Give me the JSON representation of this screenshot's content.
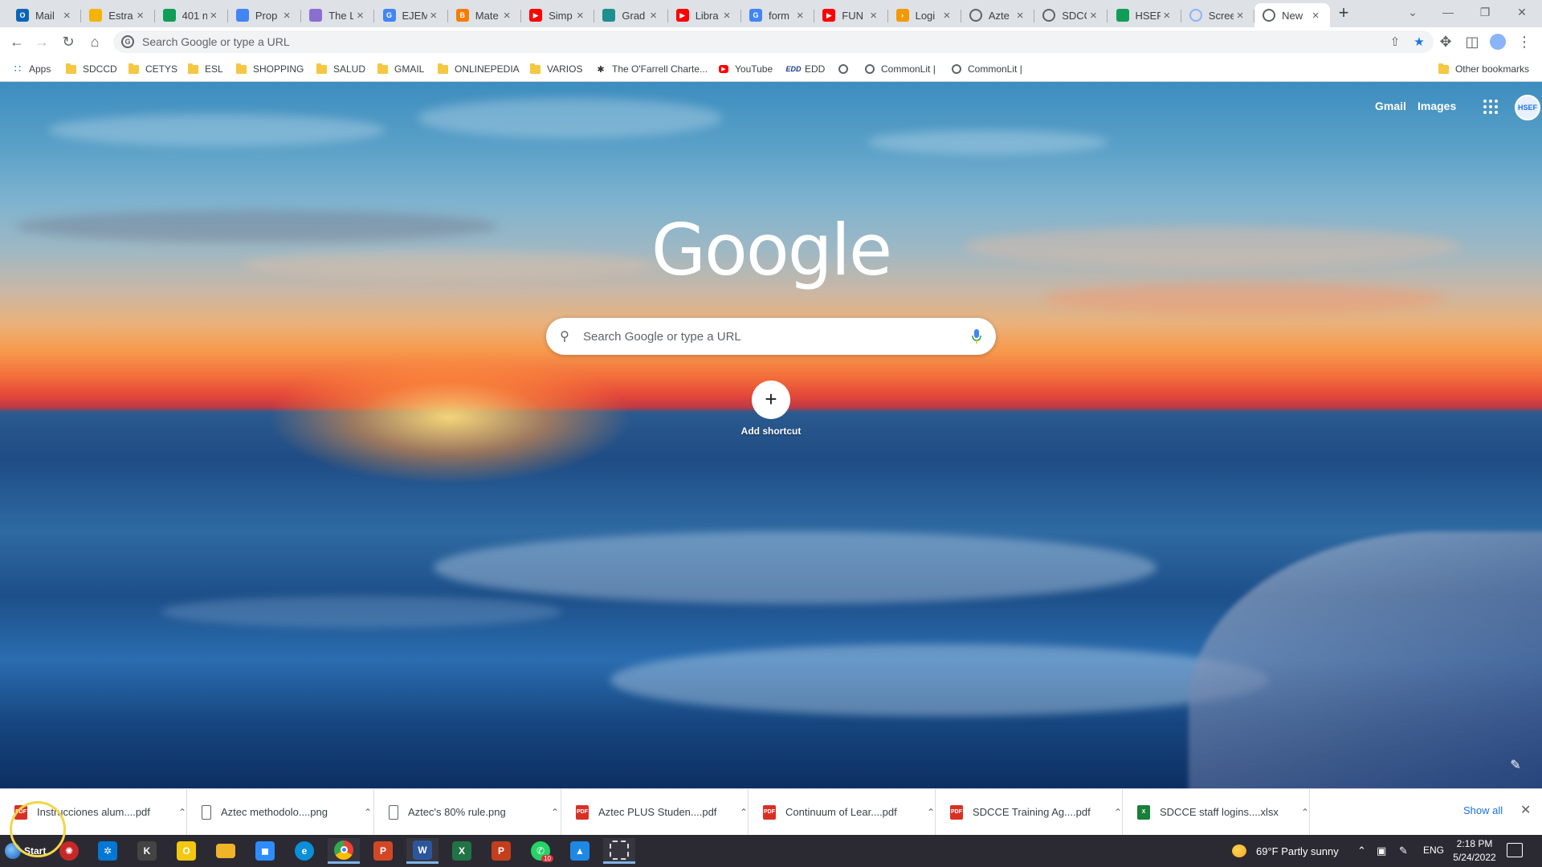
{
  "browser": {
    "tabs": [
      {
        "title": "Mail",
        "icon": "outlook-icon",
        "color": "#0a64b8",
        "glyph": "O"
      },
      {
        "title": "Estra",
        "icon": "slides-icon",
        "color": "#f4b400",
        "glyph": ""
      },
      {
        "title": "401 n",
        "icon": "sheets-icon",
        "color": "#0f9d58",
        "glyph": ""
      },
      {
        "title": "Prop",
        "icon": "docs-icon",
        "color": "#4285f4",
        "glyph": ""
      },
      {
        "title": "The L",
        "icon": "webpage-icon",
        "color": "#8a6fd1",
        "glyph": ""
      },
      {
        "title": "EJEM",
        "icon": "google-icon",
        "color": "#4285f4",
        "glyph": "G"
      },
      {
        "title": "Mate",
        "icon": "blogger-icon",
        "color": "#f57d00",
        "glyph": "B"
      },
      {
        "title": "Simp",
        "icon": "youtube-icon",
        "color": "#ff0000",
        "glyph": "▶"
      },
      {
        "title": "Grad",
        "icon": "webpage-icon",
        "color": "#1e8e8e",
        "glyph": ""
      },
      {
        "title": "Libra",
        "icon": "youtube-icon",
        "color": "#ff0000",
        "glyph": "▶"
      },
      {
        "title": "form",
        "icon": "google-icon",
        "color": "#4285f4",
        "glyph": "G"
      },
      {
        "title": "FUN",
        "icon": "youtube-icon",
        "color": "#ff0000",
        "glyph": "▶"
      },
      {
        "title": "Logi",
        "icon": "arrow-icon",
        "color": "#f29900",
        "glyph": "›"
      },
      {
        "title": "Azte",
        "icon": "globe-icon",
        "color": "#5f6368",
        "glyph": ""
      },
      {
        "title": "SDCC",
        "icon": "globe-icon",
        "color": "#5f6368",
        "glyph": ""
      },
      {
        "title": "HSEF",
        "icon": "sheets-icon",
        "color": "#0f9d58",
        "glyph": ""
      },
      {
        "title": "Scree",
        "icon": "loading-icon",
        "color": "#8ab4f8",
        "glyph": ""
      },
      {
        "title": "New",
        "icon": "chrome-icon",
        "color": "#5f6368",
        "glyph": ""
      }
    ],
    "omnibox_placeholder": "Search Google or type a URL",
    "bookmarks": [
      {
        "label": "Apps",
        "icon": "apps-grid-icon"
      },
      {
        "label": "SDCCD",
        "icon": "folder-icon"
      },
      {
        "label": "CETYS",
        "icon": "folder-icon"
      },
      {
        "label": "ESL",
        "icon": "folder-icon"
      },
      {
        "label": "SHOPPING",
        "icon": "folder-icon"
      },
      {
        "label": "SALUD",
        "icon": "folder-icon"
      },
      {
        "label": "GMAIL",
        "icon": "folder-icon"
      },
      {
        "label": "ONLINEPEDIA",
        "icon": "folder-icon"
      },
      {
        "label": "VARIOS",
        "icon": "folder-icon"
      },
      {
        "label": "The O'Farrell Charte...",
        "icon": "school-icon"
      },
      {
        "label": "YouTube",
        "icon": "youtube-icon"
      },
      {
        "label": "EDD",
        "icon": "edd-icon"
      },
      {
        "label": "",
        "icon": "globe-icon"
      },
      {
        "label": "CommonLit |",
        "icon": "globe-icon"
      },
      {
        "label": "CommonLit |",
        "icon": "globe-icon"
      }
    ],
    "other_bookmarks": "Other bookmarks"
  },
  "ntp": {
    "gmail": "Gmail",
    "images": "Images",
    "logo": "Google",
    "search_placeholder": "Search Google or type a URL",
    "add_shortcut": "Add shortcut",
    "add_glyph": "+",
    "avatar_text": "HSEF"
  },
  "downloads": {
    "items": [
      {
        "name": "Instrucciones alum....pdf",
        "type": "pdf"
      },
      {
        "name": "Aztec methodolo....png",
        "type": "png"
      },
      {
        "name": "Aztec's 80% rule.png",
        "type": "png"
      },
      {
        "name": "Aztec PLUS Studen....pdf",
        "type": "pdf"
      },
      {
        "name": "Continuum of Lear....pdf",
        "type": "pdf"
      },
      {
        "name": "SDCCE Training Ag....pdf",
        "type": "pdf"
      },
      {
        "name": "SDCCE staff logins....xlsx",
        "type": "xlsx"
      }
    ],
    "show_all": "Show all"
  },
  "taskbar": {
    "start": "Start",
    "apps": [
      {
        "name": "antivirus-icon",
        "color": "#c62828",
        "glyph": "✺"
      },
      {
        "name": "settings-icon",
        "color": "#0078d4",
        "glyph": "✲"
      },
      {
        "name": "app-icon",
        "color": "#444",
        "glyph": "K"
      },
      {
        "name": "sticky-notes-icon",
        "color": "#f2c811",
        "glyph": "O"
      },
      {
        "name": "file-explorer-icon",
        "color": "#f0b429",
        "glyph": ""
      },
      {
        "name": "zoom-icon",
        "color": "#2d8cff",
        "glyph": "◼"
      },
      {
        "name": "edge-icon",
        "color": "#0c8ed9",
        "glyph": "e"
      },
      {
        "name": "chrome-icon",
        "color": "#e94235",
        "glyph": ""
      },
      {
        "name": "powerpoint-icon",
        "color": "#d24726",
        "glyph": "P"
      },
      {
        "name": "word-icon",
        "color": "#2b579a",
        "glyph": "W"
      },
      {
        "name": "excel-icon",
        "color": "#217346",
        "glyph": "X"
      },
      {
        "name": "powerpoint-file-icon",
        "color": "#c43e1c",
        "glyph": "P"
      },
      {
        "name": "whatsapp-icon",
        "color": "#25d366",
        "glyph": "✆"
      },
      {
        "name": "photos-icon",
        "color": "#1e88e5",
        "glyph": "▲"
      },
      {
        "name": "snipping-tool-icon",
        "color": "#555",
        "glyph": ""
      }
    ],
    "whatsapp_badge": "10",
    "weather": "69°F  Partly sunny",
    "language": "ENG",
    "time": "2:18 PM",
    "date": "5/24/2022"
  }
}
